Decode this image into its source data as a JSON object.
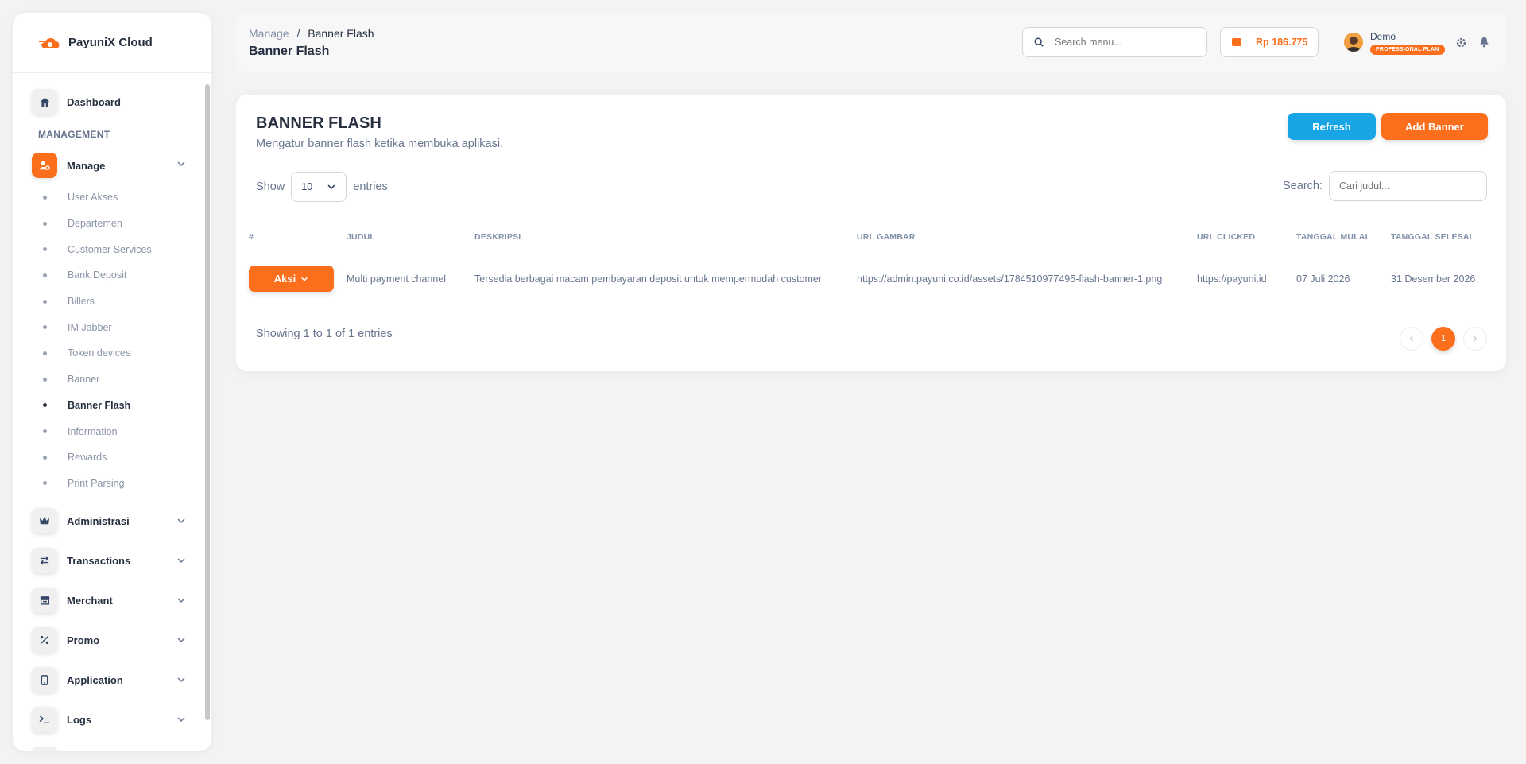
{
  "brand": {
    "title": "PayuniX Cloud"
  },
  "sidebar": {
    "dashboard": "Dashboard",
    "section": "MANAGEMENT",
    "manage": "Manage",
    "manage_items": [
      "User Akses",
      "Departemen",
      "Customer Services",
      "Bank Deposit",
      "Billers",
      "IM Jabber",
      "Token devices",
      "Banner",
      "Banner Flash",
      "Information",
      "Rewards",
      "Print Parsing"
    ],
    "active_item": "Banner Flash",
    "groups": [
      "Administrasi",
      "Transactions",
      "Merchant",
      "Promo",
      "Application",
      "Logs"
    ]
  },
  "header": {
    "crumb_parent": "Manage",
    "crumb_sep": "/",
    "crumb_current": "Banner Flash",
    "title": "Banner Flash",
    "search_placeholder": "Search menu...",
    "balance": "Rp 186.775",
    "user_name": "Demo",
    "plan": "PROFESSIONAL PLAN"
  },
  "card": {
    "title": "BANNER FLASH",
    "subtitle": "Mengatur banner flash ketika membuka aplikasi.",
    "refresh_label": "Refresh",
    "add_label": "Add Banner",
    "show_label": "Show",
    "entries_value": "10",
    "entries_label": "entries",
    "search_label": "Search:",
    "search_placeholder": "Cari judul...",
    "columns": [
      "#",
      "JUDUL",
      "DESKRIPSI",
      "URL GAMBAR",
      "URL CLICKED",
      "TANGGAL MULAI",
      "TANGGAL SELESAI"
    ],
    "rows": [
      {
        "action": "Aksi",
        "judul": "Multi payment channel",
        "deskripsi": "Tersedia berbagai macam pembayaran deposit untuk mempermudah customer",
        "url_gambar": "https://admin.payuni.co.id/assets/1784510977495-flash-banner-1.png",
        "url_clicked": "https://payuni.id",
        "tanggal_mulai": "07 Juli 2026",
        "tanggal_selesai": "31 Desember 2026"
      }
    ],
    "info": "Showing 1 to 1 of 1 entries",
    "page": "1"
  },
  "colors": {
    "accent": "#fb6e1b",
    "refresh": "#17a5e6"
  }
}
